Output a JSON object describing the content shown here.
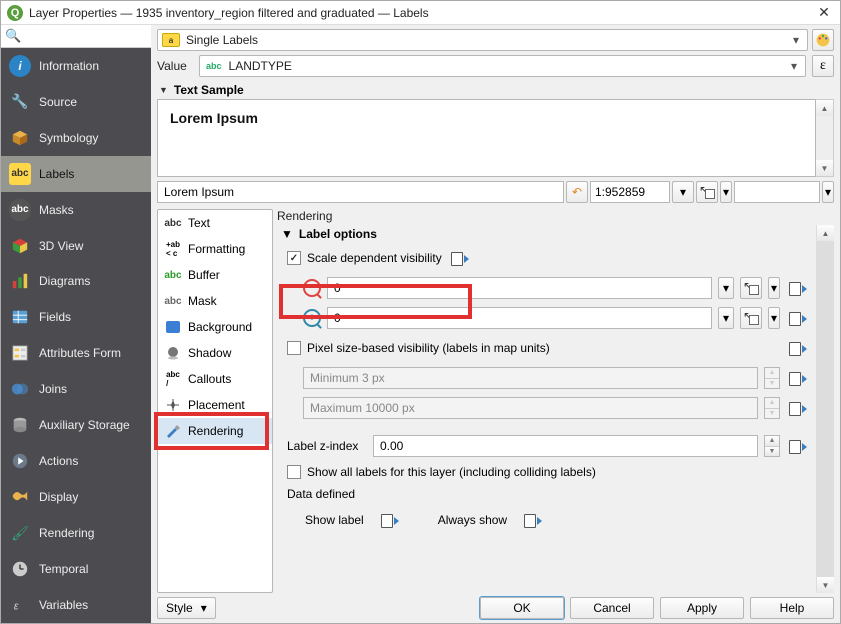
{
  "title": "Layer Properties — 1935 inventory_region filtered and graduated — Labels",
  "sidebar": {
    "search_placeholder": "",
    "items": [
      {
        "label": "Information"
      },
      {
        "label": "Source"
      },
      {
        "label": "Symbology"
      },
      {
        "label": "Labels"
      },
      {
        "label": "Masks"
      },
      {
        "label": "3D View"
      },
      {
        "label": "Diagrams"
      },
      {
        "label": "Fields"
      },
      {
        "label": "Attributes Form"
      },
      {
        "label": "Joins"
      },
      {
        "label": "Auxiliary Storage"
      },
      {
        "label": "Actions"
      },
      {
        "label": "Display"
      },
      {
        "label": "Rendering"
      },
      {
        "label": "Temporal"
      },
      {
        "label": "Variables"
      }
    ]
  },
  "labelmode": {
    "text": "Single Labels"
  },
  "value": {
    "label": "Value",
    "text": "LANDTYPE",
    "abc": "abc"
  },
  "textsample": {
    "header": "Text Sample",
    "sample": "Lorem Ipsum",
    "input": "Lorem Ipsum"
  },
  "scale": {
    "text": "1:952859"
  },
  "tabs": [
    {
      "label": "Text",
      "icon": "abc"
    },
    {
      "label": "Formatting",
      "icon": "fmt"
    },
    {
      "label": "Buffer",
      "icon": "buf"
    },
    {
      "label": "Mask",
      "icon": "msk"
    },
    {
      "label": "Background",
      "icon": "bkg"
    },
    {
      "label": "Shadow",
      "icon": "shd"
    },
    {
      "label": "Callouts",
      "icon": "cal"
    },
    {
      "label": "Placement",
      "icon": "plc"
    },
    {
      "label": "Rendering",
      "icon": "rnd"
    }
  ],
  "rendering": {
    "title": "Rendering",
    "labeloptions": "Label options",
    "scale_vis": "Scale dependent visibility",
    "min_scale": "0",
    "max_scale": "0",
    "pixel_vis": "Pixel size-based visibility (labels in map units)",
    "min_px": "Minimum 3 px",
    "max_px": "Maximum 10000 px",
    "zindex_label": "Label z-index",
    "zindex": "0.00",
    "show_all": "Show all labels for this layer (including colliding labels)",
    "datadef": "Data defined",
    "show_label": "Show label",
    "always_show": "Always show"
  },
  "footer": {
    "style": "Style",
    "ok": "OK",
    "cancel": "Cancel",
    "apply": "Apply",
    "help": "Help"
  }
}
